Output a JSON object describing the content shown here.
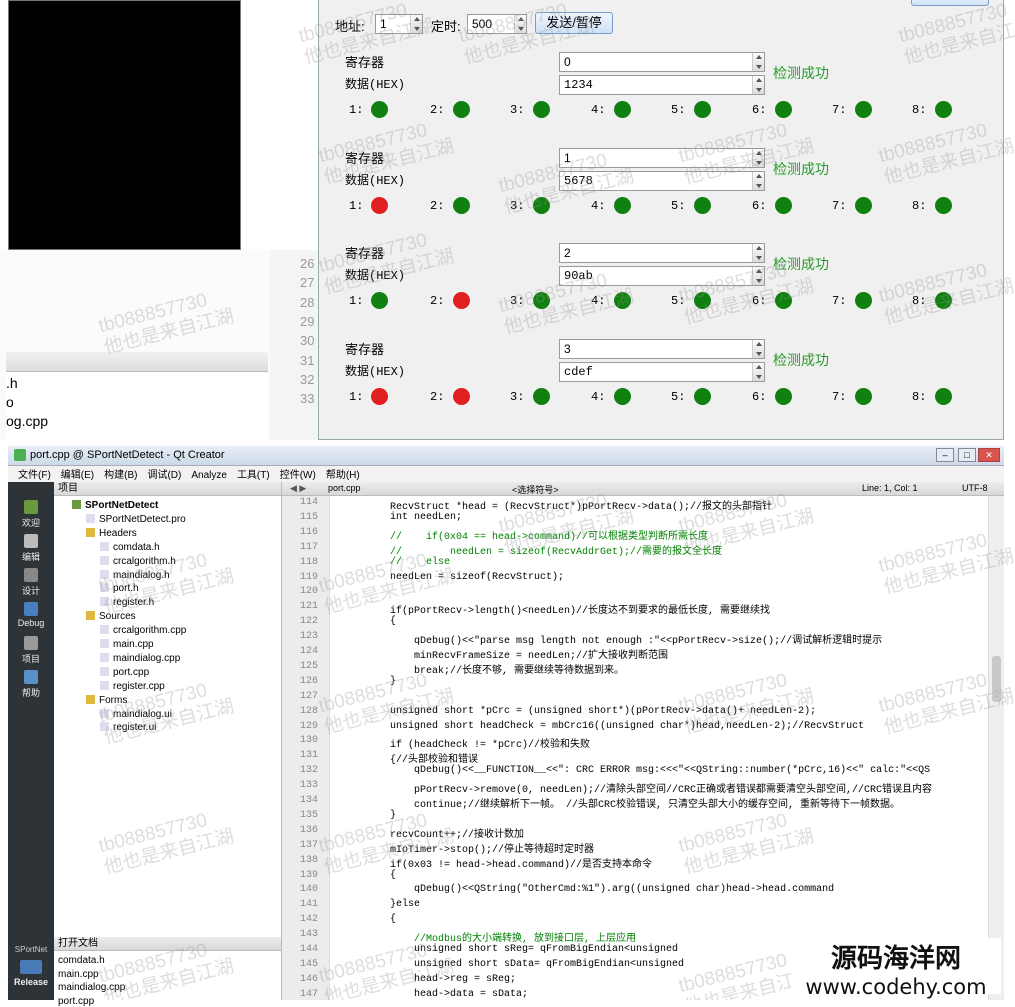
{
  "dialog": {
    "address_label": "地址:",
    "address_value": "1",
    "timer_label": "定时:",
    "timer_value": "500",
    "send_button": "发送/暂停",
    "register_label": "寄存器",
    "data_label": "数据(HEX)",
    "groups": [
      {
        "register": "0",
        "data": "1234",
        "status": "检测成功",
        "leds": [
          "green",
          "green",
          "green",
          "green",
          "green",
          "green",
          "green",
          "green"
        ]
      },
      {
        "register": "1",
        "data": "5678",
        "status": "检测成功",
        "leds": [
          "red",
          "green",
          "green",
          "green",
          "green",
          "green",
          "green",
          "green"
        ]
      },
      {
        "register": "2",
        "data": "90ab",
        "status": "检测成功",
        "leds": [
          "green",
          "red",
          "green",
          "green",
          "green",
          "green",
          "green",
          "green"
        ]
      },
      {
        "register": "3",
        "data": "cdef",
        "status": "检测成功",
        "leds": [
          "red",
          "red",
          "green",
          "green",
          "green",
          "green",
          "green",
          "green"
        ]
      }
    ],
    "led_labels": [
      "1:",
      "2:",
      "3:",
      "4:",
      "5:",
      "6:",
      "7:",
      "8:"
    ]
  },
  "colors": {
    "led_green": "#108010",
    "led_red": "#e02020",
    "status_green": "#2a9a2a"
  },
  "background_editor": {
    "line_numbers": [
      "26",
      "27",
      "28",
      "29",
      "30",
      "31",
      "32",
      "33"
    ],
    "side_list": [
      ".h",
      "o",
      "og.cpp"
    ]
  },
  "qtcreator": {
    "title": "port.cpp @ SPortNetDetect - Qt Creator",
    "menu": [
      "文件(F)",
      "编辑(E)",
      "构建(B)",
      "调试(D)",
      "Analyze",
      "工具(T)",
      "控件(W)",
      "帮助(H)"
    ],
    "modes": [
      "欢迎",
      "编辑",
      "设计",
      "Debug",
      "项目",
      "帮助"
    ],
    "kit_label": "SPortNet",
    "release_label": "Release",
    "project_pane_title": "项目",
    "tree": [
      {
        "label": "SPortNetDetect",
        "level": 0,
        "bold": true
      },
      {
        "label": "SPortNetDetect.pro",
        "level": 1
      },
      {
        "label": "Headers",
        "level": 1
      },
      {
        "label": "comdata.h",
        "level": 2
      },
      {
        "label": "crcalgorithm.h",
        "level": 2
      },
      {
        "label": "maindialog.h",
        "level": 2
      },
      {
        "label": "port.h",
        "level": 2
      },
      {
        "label": "register.h",
        "level": 2
      },
      {
        "label": "Sources",
        "level": 1
      },
      {
        "label": "crcalgorithm.cpp",
        "level": 2
      },
      {
        "label": "main.cpp",
        "level": 2
      },
      {
        "label": "maindialog.cpp",
        "level": 2
      },
      {
        "label": "port.cpp",
        "level": 2
      },
      {
        "label": "register.cpp",
        "level": 2
      },
      {
        "label": "Forms",
        "level": 1
      },
      {
        "label": "maindialog.ui",
        "level": 2
      },
      {
        "label": "register.ui",
        "level": 2
      }
    ],
    "open_docs_title": "打开文档",
    "open_docs": [
      "comdata.h",
      "main.cpp",
      "maindialog.cpp",
      "port.cpp"
    ],
    "editor_tab": "port.cpp",
    "symbol_combo": "<选择符号>",
    "cursor_pos": "Line: 1, Col: 1",
    "encoding": "UTF-8",
    "code_lines": [
      {
        "n": "114",
        "t": "RecvStruct *head = (RecvStruct*)pPortRecv->data();//报文的头部指针"
      },
      {
        "n": "115",
        "t": "int needLen;"
      },
      {
        "n": "116",
        "t": "//    if(0x04 == head->command)//可以根据类型判断所需长度"
      },
      {
        "n": "117",
        "t": "//        needLen = sizeof(RecvAddrGet);//需要的报文全长度"
      },
      {
        "n": "118",
        "t": "//    else"
      },
      {
        "n": "119",
        "t": "needLen = sizeof(RecvStruct);"
      },
      {
        "n": "120",
        "t": ""
      },
      {
        "n": "121",
        "t": "if(pPortRecv->length()<needLen)//长度达不到要求的最低长度, 需要继续找"
      },
      {
        "n": "122",
        "t": "{"
      },
      {
        "n": "123",
        "t": "    qDebug()<<\"parse msg length not enough :\"<<pPortRecv->size();//调试解析逻辑时提示"
      },
      {
        "n": "124",
        "t": "    minRecvFrameSize = needLen;//扩大接收判断范围"
      },
      {
        "n": "125",
        "t": "    break;//长度不够, 需要继续等待数据到来。"
      },
      {
        "n": "126",
        "t": "}"
      },
      {
        "n": "127",
        "t": ""
      },
      {
        "n": "128",
        "t": "unsigned short *pCrc = (unsigned short*)(pPortRecv->data()+ needLen-2);"
      },
      {
        "n": "129",
        "t": "unsigned short headCheck = mbCrc16((unsigned char*)head,needLen-2);//RecvStruct"
      },
      {
        "n": "130",
        "t": "if (headCheck != *pCrc)//校验和失败"
      },
      {
        "n": "131",
        "t": "{//头部校验和错误"
      },
      {
        "n": "132",
        "t": "    qDebug()<<__FUNCTION__<<\": CRC ERROR msg:<<<\"<<QString::number(*pCrc,16)<<\" calc:\"<<QS"
      },
      {
        "n": "133",
        "t": "    pPortRecv->remove(0, needLen);//清除头部空间//CRC正确或者错误都需要清空头部空间,//CRC错误且内容"
      },
      {
        "n": "134",
        "t": "    continue;//继续解析下一帧。 //头部CRC校验错误, 只清空头部大小的缓存空间, 重新等待下一帧数据。"
      },
      {
        "n": "135",
        "t": "}"
      },
      {
        "n": "136",
        "t": "recvCount++;//接收计数加"
      },
      {
        "n": "137",
        "t": "mIoTimer->stop();//停止等待超时定时器"
      },
      {
        "n": "138",
        "t": "if(0x03 != head->head.command)//是否支持本命令"
      },
      {
        "n": "139",
        "t": "{"
      },
      {
        "n": "140",
        "t": "    qDebug()<<QString(\"OtherCmd:%1\").arg((unsigned char)head->head.command"
      },
      {
        "n": "141",
        "t": "}else"
      },
      {
        "n": "142",
        "t": "{"
      },
      {
        "n": "143",
        "t": "    //Modbus的大小端转换, 放到接口层, 上层应用"
      },
      {
        "n": "144",
        "t": "    unsigned short sReg= qFromBigEndian<unsigned"
      },
      {
        "n": "145",
        "t": "    unsigned short sData= qFromBigEndian<unsigned"
      },
      {
        "n": "146",
        "t": "    head->reg = sReg;"
      },
      {
        "n": "147",
        "t": "    head->data = sData;"
      }
    ]
  },
  "watermark": {
    "line1": "tb088857730",
    "line2": "他也是来自江湖"
  },
  "site_logo": {
    "name": "源码海洋网",
    "url": "www.codehy.com"
  }
}
